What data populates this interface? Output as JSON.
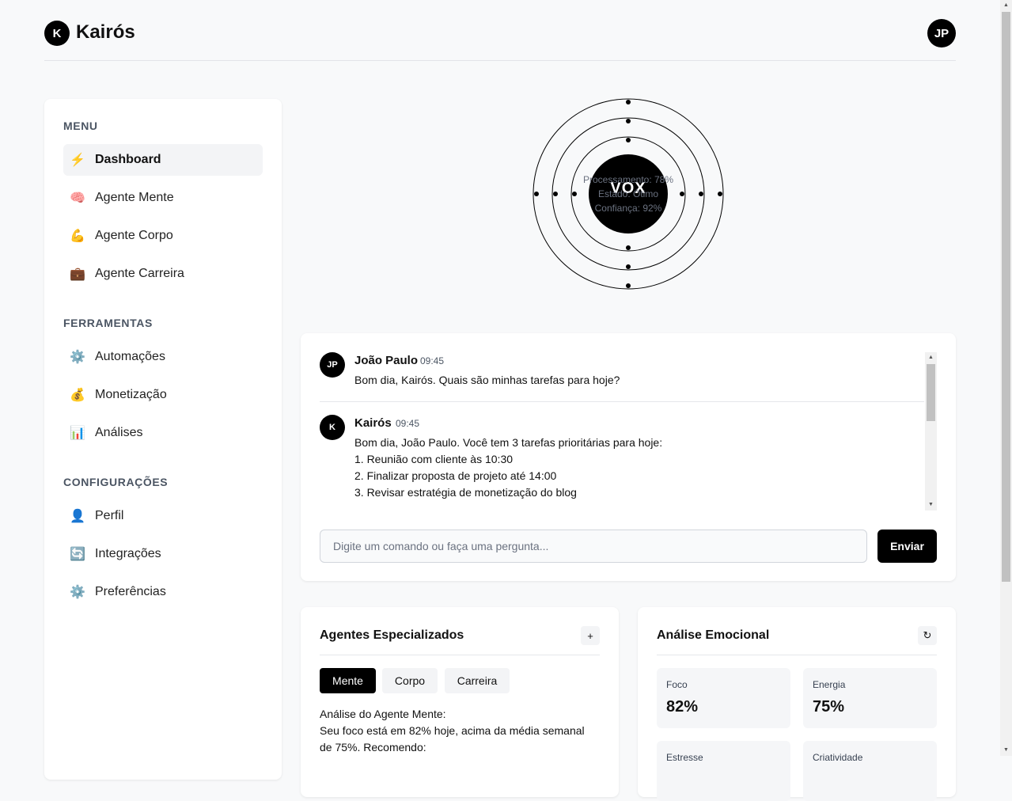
{
  "app": {
    "logo_letter": "K",
    "name": "Kairós",
    "user_initials": "JP"
  },
  "sidebar": {
    "sections": [
      {
        "title": "MENU",
        "items": [
          {
            "icon": "⚡",
            "icon_name": "lightning-icon",
            "label": "Dashboard",
            "active": true
          },
          {
            "icon": "🧠",
            "icon_name": "brain-icon",
            "label": "Agente Mente"
          },
          {
            "icon": "💪",
            "icon_name": "muscle-icon",
            "label": "Agente Corpo"
          },
          {
            "icon": "💼",
            "icon_name": "briefcase-icon",
            "label": "Agente Carreira"
          }
        ]
      },
      {
        "title": "FERRAMENTAS",
        "items": [
          {
            "icon": "⚙️",
            "icon_name": "gear-icon",
            "label": "Automações"
          },
          {
            "icon": "💰",
            "icon_name": "money-bag-icon",
            "label": "Monetização"
          },
          {
            "icon": "📊",
            "icon_name": "bar-chart-icon",
            "label": "Análises"
          }
        ]
      },
      {
        "title": "CONFIGURAÇÕES",
        "items": [
          {
            "icon": "👤",
            "icon_name": "user-icon",
            "label": "Perfil"
          },
          {
            "icon": "🔄",
            "icon_name": "sync-icon",
            "label": "Integrações"
          },
          {
            "icon": "⚙️",
            "icon_name": "gear-icon",
            "label": "Preferências"
          }
        ]
      }
    ]
  },
  "vox": {
    "label": "VOX",
    "processing": "Processamento: 78%",
    "state": "Estado: Ótimo",
    "confidence": "Confiança: 92%"
  },
  "chat": {
    "messages": [
      {
        "initials": "JP",
        "name": "João Paulo",
        "time": "09:45",
        "lines": [
          "Bom dia, Kairós. Quais são minhas tarefas para hoje?"
        ]
      },
      {
        "initials": "K",
        "name": "Kairós",
        "time": "09:45",
        "lines": [
          "Bom dia, João Paulo. Você tem 3 tarefas prioritárias para hoje:",
          "1. Reunião com cliente às 10:30",
          "2. Finalizar proposta de projeto até 14:00",
          "3. Revisar estratégia de monetização do blog"
        ]
      }
    ],
    "input_placeholder": "Digite um comando ou faça uma pergunta...",
    "input_value": "",
    "send_label": "Enviar"
  },
  "agents": {
    "title": "Agentes Especializados",
    "add_label": "+",
    "tabs": [
      "Mente",
      "Corpo",
      "Carreira"
    ],
    "active_tab": "Mente",
    "text_lines": [
      "Análise do Agente Mente:",
      "Seu foco está em 82% hoje, acima da média semanal de 75%. Recomendo:"
    ]
  },
  "emotional": {
    "title": "Análise Emocional",
    "refresh_label": "↻",
    "metrics": [
      {
        "label": "Foco",
        "value": "82%"
      },
      {
        "label": "Energia",
        "value": "75%"
      },
      {
        "label": "Estresse",
        "value": ""
      },
      {
        "label": "Criatividade",
        "value": ""
      }
    ]
  }
}
